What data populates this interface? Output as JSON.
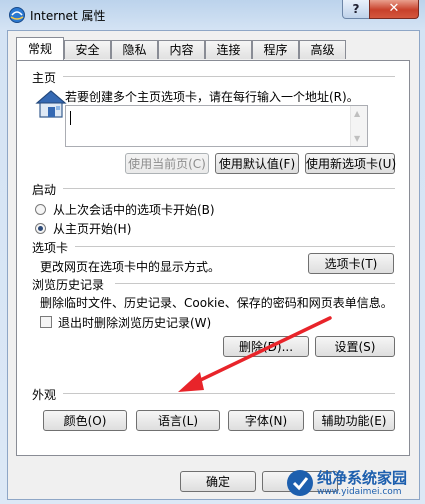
{
  "window": {
    "title": "Internet 属性",
    "help_label": "?",
    "close_label": "✕",
    "icon": "internet-explorer-icon"
  },
  "tabs": [
    {
      "label": "常规",
      "active": true
    },
    {
      "label": "安全"
    },
    {
      "label": "隐私"
    },
    {
      "label": "内容"
    },
    {
      "label": "连接"
    },
    {
      "label": "程序"
    },
    {
      "label": "高级"
    }
  ],
  "homepage": {
    "label": "主页",
    "description": "若要创建多个主页选项卡，请在每行输入一个地址(R)。",
    "icon": "house-icon",
    "url_value": "",
    "use_current": "使用当前页(C)",
    "use_default": "使用默认值(F)",
    "use_new_tab": "使用新选项卡(U)"
  },
  "startup": {
    "label": "启动",
    "option_last_session": "从上次会话中的选项卡开始(B)",
    "option_homepage": "从主页开始(H)",
    "selected": "option_homepage"
  },
  "tabs_section": {
    "label": "选项卡",
    "description": "更改网页在选项卡中的显示方式。",
    "button": "选项卡(T)"
  },
  "history": {
    "label": "浏览历史记录",
    "description": "删除临时文件、历史记录、Cookie、保存的密码和网页表单信息。",
    "delete_on_exit": "退出时删除浏览历史记录(W)",
    "delete_on_exit_checked": false,
    "delete_button": "删除(D)...",
    "settings_button": "设置(S)"
  },
  "appearance": {
    "label": "外观",
    "colors": "颜色(O)",
    "languages": "语言(L)",
    "fonts": "字体(N)",
    "accessibility": "辅助功能(E)"
  },
  "footer": {
    "ok": "确定"
  },
  "watermark": {
    "text": "纯净系统家园",
    "url": "www.yidaimei.com"
  },
  "colors": {
    "accent": "#3c78c8",
    "arrow": "#e8242a",
    "watermark": "#1d5fae"
  }
}
